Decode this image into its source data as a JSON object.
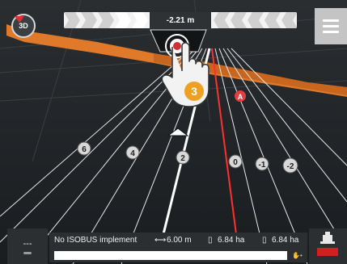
{
  "view": {
    "view_mode_label": "3D",
    "swath_labels": [
      "6",
      "4",
      "2",
      "0",
      "-1",
      "-2"
    ],
    "active_line_label": "A",
    "point_a_label": "A",
    "tutorial_step": "3"
  },
  "lightbar": {
    "offset": "-2.21 m"
  },
  "status": {
    "implement": "No ISOBUS implement",
    "working_width": "6.00 m",
    "area_1": "6.84 ha",
    "area_2": "6.84 ha",
    "left_box_label": "---",
    "progress_fraction": 0.0
  },
  "colors": {
    "field_boundary": "#e07a2a",
    "guidance_active": "#ff3030",
    "point_a": "#e04040",
    "tutorial_badge": "#f0a020"
  },
  "icons": {
    "view3d": "3d-view-icon",
    "menu": "hamburger-menu-icon",
    "hand": "hand-pointer-icon",
    "width": "working-width-icon",
    "area": "area-counter-icon",
    "implement": "implement-icon"
  }
}
